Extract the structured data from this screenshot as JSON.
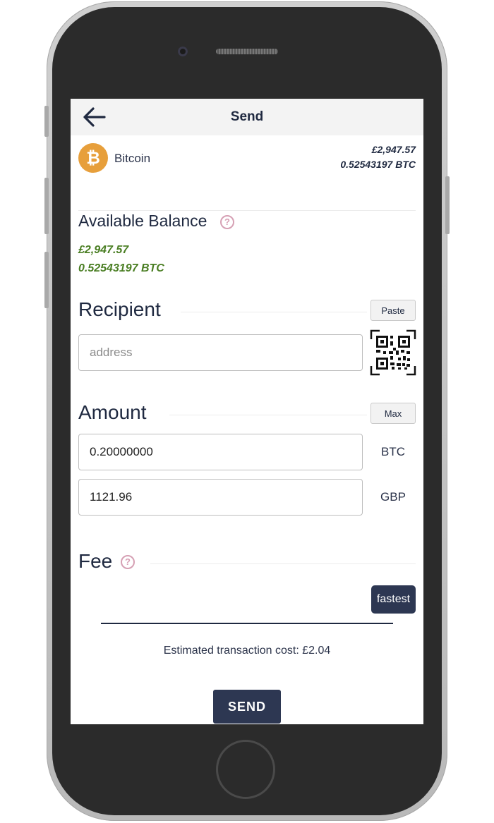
{
  "header": {
    "title": "Send",
    "back_icon": "arrow-left-icon"
  },
  "coin": {
    "name": "Bitcoin",
    "icon": "bitcoin-icon",
    "balance_fiat": "£2,947.57",
    "balance_crypto": "0.52543197 BTC"
  },
  "available": {
    "label": "Available Balance",
    "fiat": "£2,947.57",
    "crypto": "0.52543197 BTC",
    "help_icon": "question-icon"
  },
  "recipient": {
    "label": "Recipient",
    "paste_label": "Paste",
    "placeholder": "address",
    "qr_icon": "qr-code-icon"
  },
  "amount": {
    "label": "Amount",
    "max_label": "Max",
    "crypto_value": "0.20000000",
    "crypto_unit": "BTC",
    "fiat_value": "1121.96",
    "fiat_unit": "GBP"
  },
  "fee": {
    "label": "Fee",
    "help_icon": "question-icon",
    "level": "fastest",
    "estimate": "Estimated transaction cost: £2.04"
  },
  "send_label": "SEND",
  "colors": {
    "accent": "#2d3752",
    "balance_green": "#4a7e23",
    "bitcoin": "#e79f3b",
    "help": "#d6a0b4"
  }
}
